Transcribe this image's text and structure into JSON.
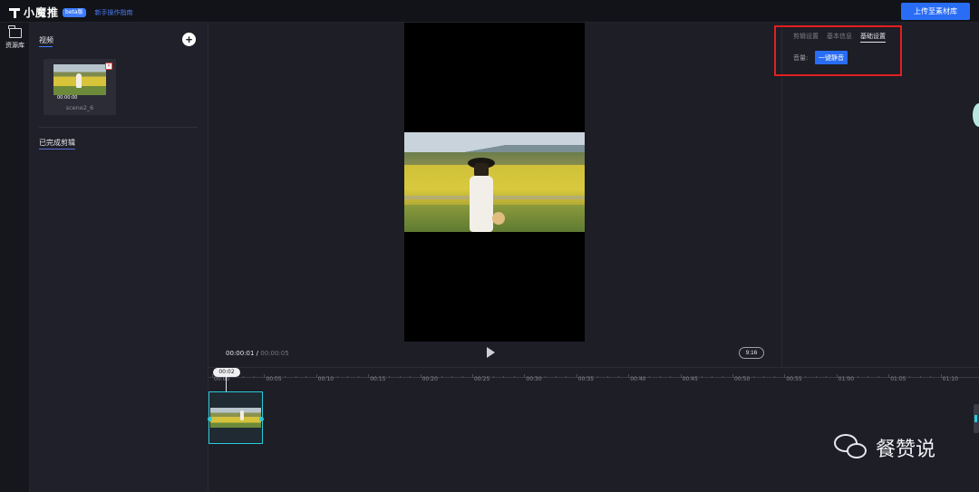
{
  "header": {
    "app_name": "小魔推",
    "beta_badge": "beta版",
    "guide_link": "新手操作指南",
    "upload_button": "上传至素材库"
  },
  "sidenav": {
    "items": [
      {
        "label": "资源库",
        "icon": "folder-icon"
      }
    ]
  },
  "assets": {
    "title": "视频",
    "add_icon": "+",
    "media": [
      {
        "name": "scene2_6",
        "duration": "00:00:00"
      }
    ],
    "done_title": "已完成剪辑"
  },
  "preview": {
    "current_time": "00:00:01",
    "separator": " / ",
    "total_time": "00:00:05",
    "ratio": "9:16"
  },
  "settings": {
    "tabs": [
      {
        "label": "剪辑设置",
        "active": false
      },
      {
        "label": "基本信息",
        "active": false
      },
      {
        "label": "基础设置",
        "active": true
      }
    ],
    "volume_label": "音量:",
    "mute_button": "一键静音"
  },
  "timeline": {
    "playhead_time": "00:02",
    "ticks": [
      "00:00",
      "00:05",
      "00:10",
      "00:15",
      "00:20",
      "00:25",
      "00:30",
      "00:35",
      "00:40",
      "00:45",
      "00:50",
      "00:55",
      "01:00",
      "01:05",
      "01:10"
    ]
  },
  "watermark": {
    "text": "餐赞说",
    "icon": "wechat-icon"
  },
  "colors": {
    "accent": "#2a6df5",
    "highlight_box": "#e41f1f",
    "clip_border": "#2bc9d8"
  }
}
